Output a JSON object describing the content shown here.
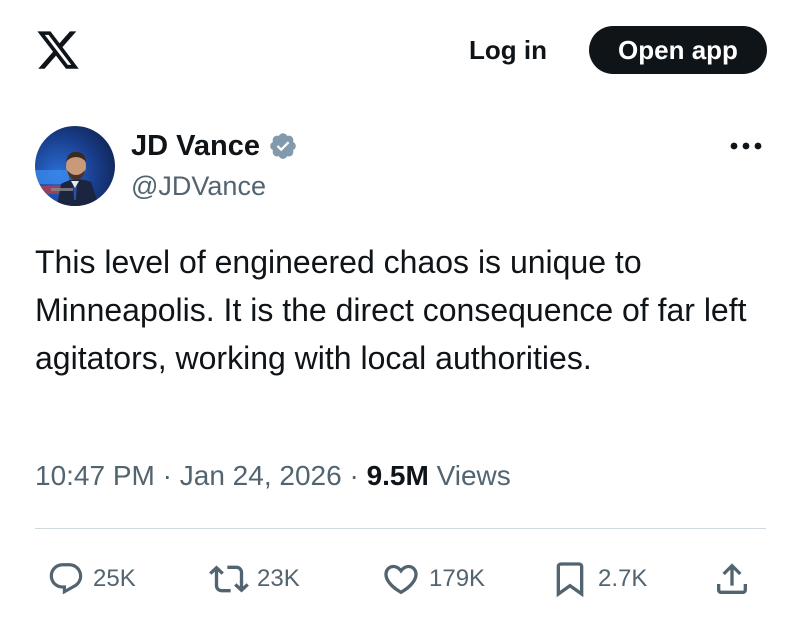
{
  "header": {
    "logo_icon": "x-logo-icon",
    "login_label": "Log in",
    "open_app_label": "Open app"
  },
  "tweet": {
    "author": {
      "display_name": "JD Vance",
      "handle": "@JDVance",
      "verified": true,
      "verified_color": "#829aab"
    },
    "text": "This level of engineered chaos is unique to Minneapolis. It is the direct consequence of far left agitators, working with local authorities.",
    "time": "10:47 PM",
    "date": "Jan 24, 2026",
    "separator": "·",
    "views_count": "9.5M",
    "views_label": "Views"
  },
  "actions": {
    "reply": {
      "icon": "reply-icon",
      "count": "25K"
    },
    "retweet": {
      "icon": "retweet-icon",
      "count": "23K"
    },
    "like": {
      "icon": "heart-icon",
      "count": "179K"
    },
    "bookmark": {
      "icon": "bookmark-icon",
      "count": "2.7K"
    },
    "share": {
      "icon": "share-icon"
    }
  },
  "colors": {
    "text_primary": "#0f1419",
    "text_secondary": "#536471",
    "divider": "#cfd9de",
    "button_dark": "#0f1419"
  }
}
